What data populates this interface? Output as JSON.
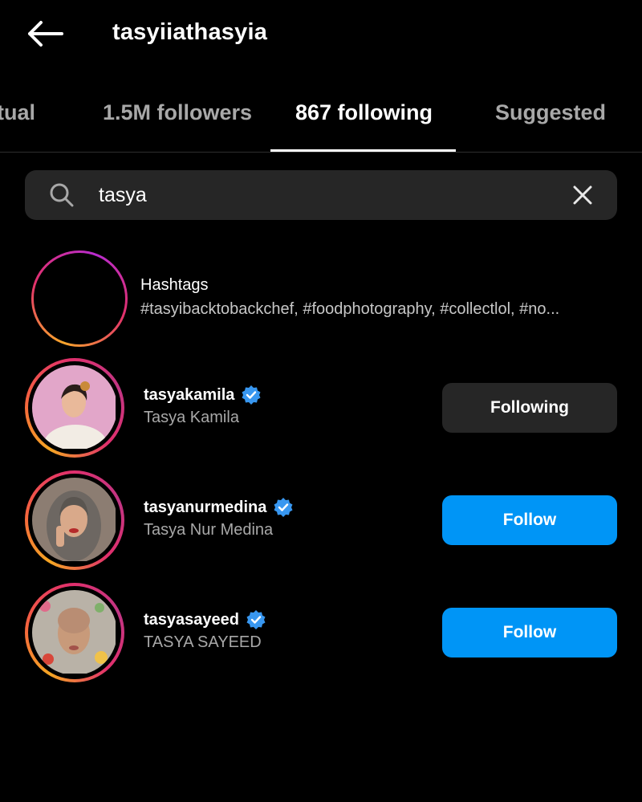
{
  "header": {
    "back_icon": "arrow-left-icon",
    "username": "tasyiiathasyia"
  },
  "tabs": [
    {
      "label": "tual",
      "active": false
    },
    {
      "label": "1.5M followers",
      "active": false
    },
    {
      "label": "867 following",
      "active": true
    },
    {
      "label": "Suggested",
      "active": false
    }
  ],
  "search": {
    "value": "tasya",
    "icon": "search-icon",
    "clear_icon": "close-icon"
  },
  "hashtags": {
    "title": "Hashtags",
    "subtitle": "#tasyibacktobackchef, #foodphotography, #collectlol, #no...",
    "icon": "hashtag-icon"
  },
  "accounts": [
    {
      "username": "tasyakamila",
      "full_name": "Tasya Kamila",
      "verified": true,
      "button_label": "Following",
      "button_style": "secondary"
    },
    {
      "username": "tasyanurmedina",
      "full_name": "Tasya Nur Medina",
      "verified": true,
      "button_label": "Follow",
      "button_style": "primary"
    },
    {
      "username": "tasyasayeed",
      "full_name": "TASYA SAYEED",
      "verified": true,
      "button_label": "Follow",
      "button_style": "primary"
    }
  ],
  "colors": {
    "background": "#000000",
    "follow_blue": "#0095f6",
    "verified_blue": "#3897f0",
    "secondary_button": "#262626",
    "muted_text": "#a8a8a8"
  }
}
